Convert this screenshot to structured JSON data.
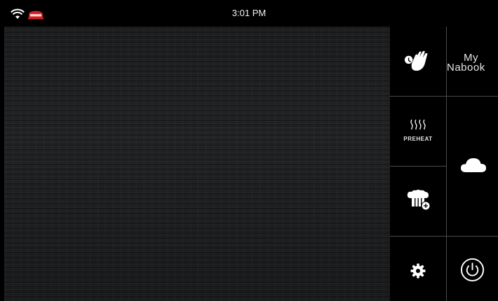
{
  "status_bar": {
    "time": "3:01 PM",
    "haccp_badge": "HACCP"
  },
  "tiles": {
    "touch": {
      "icon": "hand-touch-icon"
    },
    "mynabook": {
      "line1": "My",
      "line2": "Nabook",
      "icon": "mynabook-logo"
    },
    "preheat": {
      "label": "PREHEAT",
      "icon": "heat-waves-icon"
    },
    "cloud": {
      "icon": "cloud-icon"
    },
    "chef": {
      "icon": "chef-hat-add-icon"
    },
    "settings": {
      "icon": "gear-icon"
    },
    "power": {
      "icon": "power-icon"
    }
  },
  "colors": {
    "background": "#000000",
    "haccp_red": "#d32020",
    "icon": "#ffffff",
    "panel": "#1e1f21"
  }
}
